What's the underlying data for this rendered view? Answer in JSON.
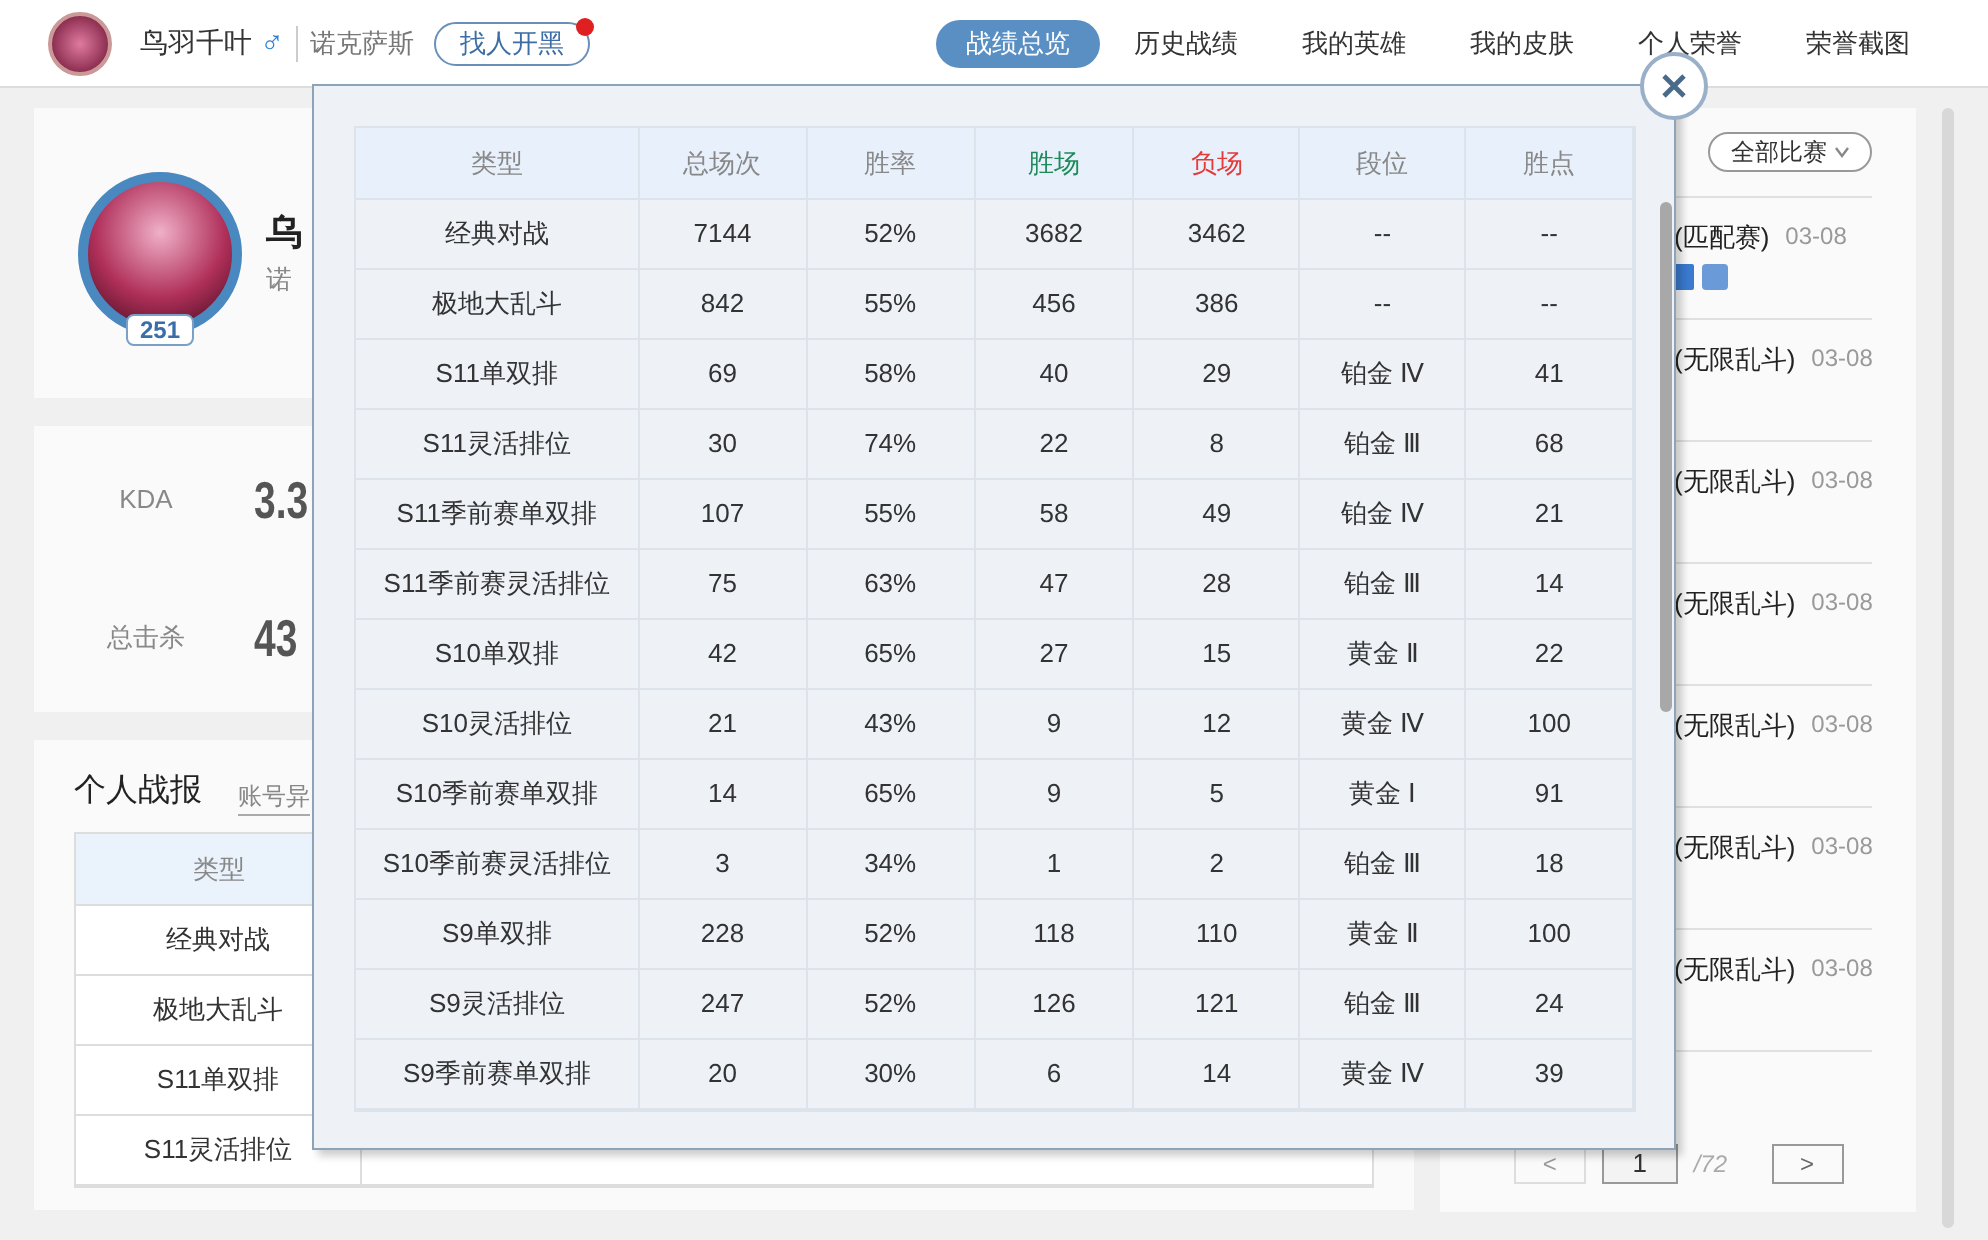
{
  "header": {
    "player_name": "鸟羽千叶",
    "gender_symbol": "♂",
    "server": "诺克萨斯",
    "find_button": {
      "label": "找人开黑",
      "notification": true
    },
    "nav": [
      {
        "label": "战绩总览",
        "selected": true
      },
      {
        "label": "历史战绩",
        "selected": false
      },
      {
        "label": "我的英雄",
        "selected": false
      },
      {
        "label": "我的皮肤",
        "selected": false
      },
      {
        "label": "个人荣誉",
        "selected": false
      },
      {
        "label": "荣誉截图",
        "selected": false
      }
    ]
  },
  "profile": {
    "level": "251",
    "name": "乌",
    "server": "诺"
  },
  "stats": [
    {
      "label": "KDA",
      "value": "3.3"
    },
    {
      "label": "总击杀",
      "value": "43"
    }
  ],
  "report": {
    "title": "个人战报",
    "link": "账号异",
    "column_1": "类型",
    "rows": [
      "经典对战",
      "极地大乱斗",
      "S11单双排",
      "S11灵活排位"
    ]
  },
  "matches": {
    "filter": "全部比赛",
    "items": [
      {
        "mode": "(匹配赛)",
        "date": "03-08",
        "icons": true
      },
      {
        "mode": "(无限乱斗)",
        "date": "03-08",
        "icons": false
      },
      {
        "mode": "(无限乱斗)",
        "date": "03-08",
        "icons": false
      },
      {
        "mode": "(无限乱斗)",
        "date": "03-08",
        "icons": false
      },
      {
        "mode": "(无限乱斗)",
        "date": "03-08",
        "icons": false
      },
      {
        "mode": "(无限乱斗)",
        "date": "03-08",
        "icons": false
      },
      {
        "mode": "(无限乱斗)",
        "date": "03-08",
        "icons": false
      }
    ],
    "pagination": {
      "previous": "<",
      "page": "1",
      "total": "/72",
      "next": ">"
    }
  },
  "modal": {
    "columns": [
      {
        "label": "类型",
        "kind": "plain"
      },
      {
        "label": "总场次",
        "kind": "plain"
      },
      {
        "label": "胜率",
        "kind": "plain"
      },
      {
        "label": "胜场",
        "kind": "win"
      },
      {
        "label": "负场",
        "kind": "loss"
      },
      {
        "label": "段位",
        "kind": "plain"
      },
      {
        "label": "胜点",
        "kind": "plain"
      }
    ],
    "rows": [
      [
        "经典对战",
        "7144",
        "52%",
        "3682",
        "3462",
        "--",
        "--"
      ],
      [
        "极地大乱斗",
        "842",
        "55%",
        "456",
        "386",
        "--",
        "--"
      ],
      [
        "S11单双排",
        "69",
        "58%",
        "40",
        "29",
        "铂金 Ⅳ",
        "41"
      ],
      [
        "S11灵活排位",
        "30",
        "74%",
        "22",
        "8",
        "铂金 Ⅲ",
        "68"
      ],
      [
        "S11季前赛单双排",
        "107",
        "55%",
        "58",
        "49",
        "铂金 Ⅳ",
        "21"
      ],
      [
        "S11季前赛灵活排位",
        "75",
        "63%",
        "47",
        "28",
        "铂金 Ⅲ",
        "14"
      ],
      [
        "S10单双排",
        "42",
        "65%",
        "27",
        "15",
        "黄金 Ⅱ",
        "22"
      ],
      [
        "S10灵活排位",
        "21",
        "43%",
        "9",
        "12",
        "黄金 Ⅳ",
        "100"
      ],
      [
        "S10季前赛单双排",
        "14",
        "65%",
        "9",
        "5",
        "黄金 Ⅰ",
        "91"
      ],
      [
        "S10季前赛灵活排位",
        "3",
        "34%",
        "1",
        "2",
        "铂金 Ⅲ",
        "18"
      ],
      [
        "S9单双排",
        "228",
        "52%",
        "118",
        "110",
        "黄金 Ⅱ",
        "100"
      ],
      [
        "S9灵活排位",
        "247",
        "52%",
        "126",
        "121",
        "铂金 Ⅲ",
        "24"
      ],
      [
        "S9季前赛单双排",
        "20",
        "30%",
        "6",
        "14",
        "黄金 Ⅳ",
        "39"
      ]
    ]
  }
}
